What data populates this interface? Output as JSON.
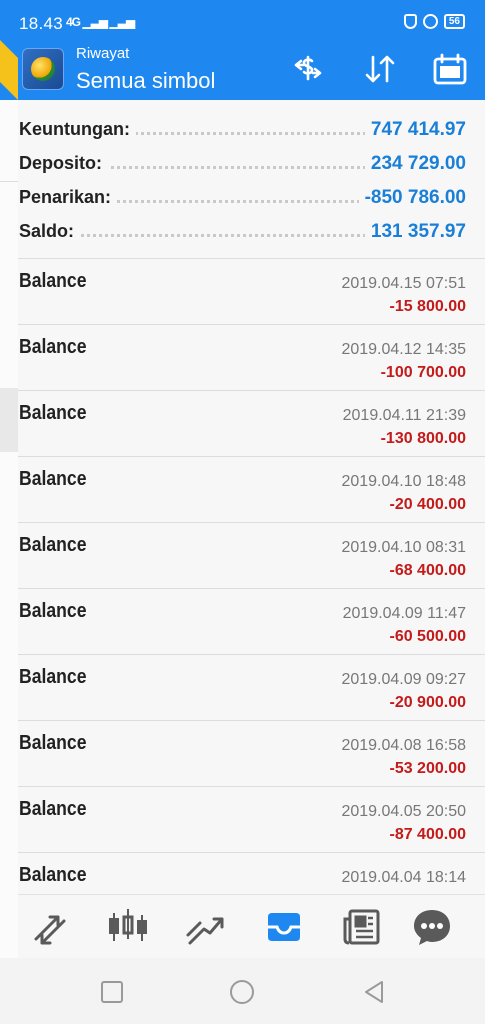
{
  "status_bar": {
    "time": "18.43",
    "network": "4G",
    "battery": "56"
  },
  "app_bar": {
    "subtitle": "Riwayat",
    "title": "Semua simbol",
    "icons": [
      "logo-icon",
      "exchange-dollar-icon",
      "sort-icon",
      "calendar-icon"
    ]
  },
  "summary": [
    {
      "label": "Keuntungan:",
      "value": "747 414.97"
    },
    {
      "label": "Deposito:",
      "value": "234 729.00"
    },
    {
      "label": "Penarikan:",
      "value": "-850 786.00"
    },
    {
      "label": "Saldo:",
      "value": "131 357.97"
    }
  ],
  "deals": [
    {
      "type": "Balance",
      "time": "2019.04.15 07:51",
      "amount": "-15 800.00"
    },
    {
      "type": "Balance",
      "time": "2019.04.12 14:35",
      "amount": "-100 700.00"
    },
    {
      "type": "Balance",
      "time": "2019.04.11 21:39",
      "amount": "-130 800.00"
    },
    {
      "type": "Balance",
      "time": "2019.04.10 18:48",
      "amount": "-20 400.00"
    },
    {
      "type": "Balance",
      "time": "2019.04.10 08:31",
      "amount": "-68 400.00"
    },
    {
      "type": "Balance",
      "time": "2019.04.09 11:47",
      "amount": "-60 500.00"
    },
    {
      "type": "Balance",
      "time": "2019.04.09 09:27",
      "amount": "-20 900.00"
    },
    {
      "type": "Balance",
      "time": "2019.04.08 16:58",
      "amount": "-53 200.00"
    },
    {
      "type": "Balance",
      "time": "2019.04.05 20:50",
      "amount": "-87 400.00"
    },
    {
      "type": "Balance",
      "time": "2019.04.04 18:14",
      "amount": ""
    }
  ],
  "bottom_nav": [
    {
      "name": "quotes",
      "icon": "quotes-arrows-icon",
      "active": false
    },
    {
      "name": "chart",
      "icon": "candlestick-icon",
      "active": false
    },
    {
      "name": "trade",
      "icon": "trend-icon",
      "active": false
    },
    {
      "name": "history",
      "icon": "inbox-icon",
      "active": true
    },
    {
      "name": "news",
      "icon": "newspaper-icon",
      "active": false
    },
    {
      "name": "messages",
      "icon": "chat-icon",
      "active": false
    }
  ],
  "colors": {
    "accent": "#1e88f0",
    "value_blue": "#1a7fd6",
    "negative": "#c41a1a",
    "icon_gray": "#5a5a5a"
  }
}
